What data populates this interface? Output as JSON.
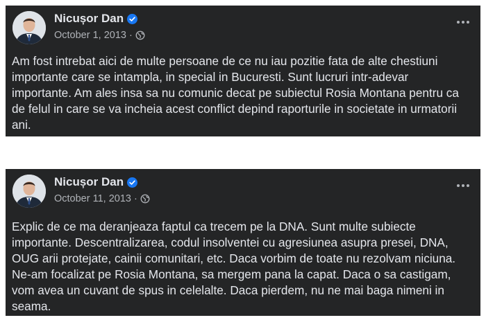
{
  "posts": [
    {
      "author": "Nicușor Dan",
      "date": "October 1, 2013",
      "separator": "·",
      "audience_icon": "globe-icon",
      "verified_icon": "verified-badge-icon",
      "text": "Am fost intrebat aici de multe persoane de ce nu iau pozitie fata de alte chestiuni importante care se intampla, in special in Bucuresti. Sunt lucruri intr-adevar importante. Am ales insa sa nu comunic decat pe subiectul Rosia Montana pentru ca de felul in care se va incheia acest conflict depind raporturile in societate in urmatorii ani."
    },
    {
      "author": "Nicușor Dan",
      "date": "October 11, 2013",
      "separator": "·",
      "audience_icon": "globe-icon",
      "verified_icon": "verified-badge-icon",
      "text": "Explic de ce ma deranjeaza faptul ca trecem pe la DNA. Sunt multe subiecte importante. Descentralizarea, codul insolventei cu agresiunea asupra presei, DNA, OUG arii protejate, cainii comunitari, etc. Daca vorbim de toate nu rezolvam niciuna. Ne-am focalizat pe Rosia Montana, sa mergem pana la capat. Daca o sa castigam, vom avea un cuvant de spus in celelalte. Daca pierdem, nu ne mai baga nimeni in seama."
    }
  ],
  "colors": {
    "card_bg": "#242526",
    "text_primary": "#e4e6eb",
    "text_secondary": "#b0b3b8",
    "verified_blue": "#1877f2"
  }
}
